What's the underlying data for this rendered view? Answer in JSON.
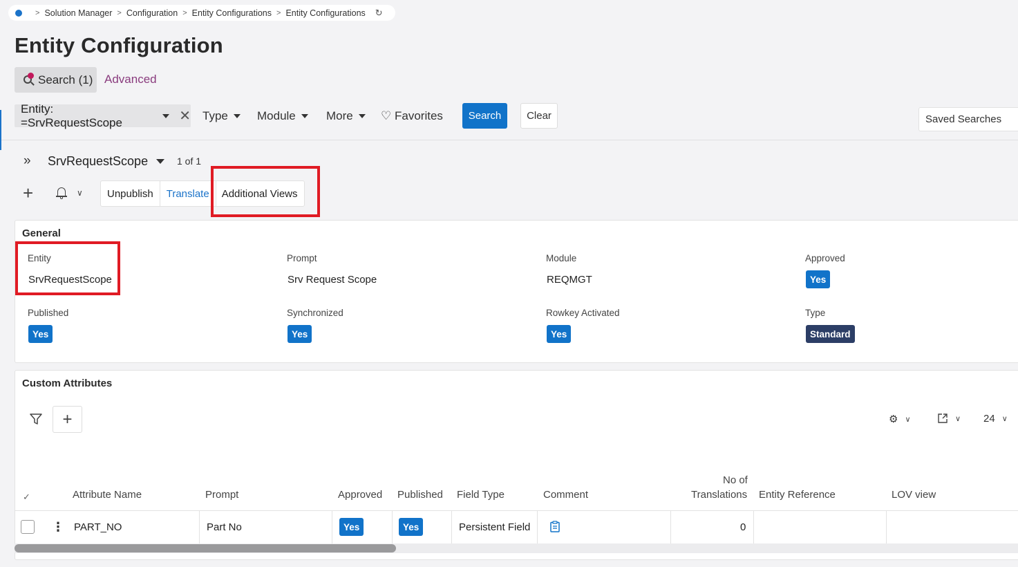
{
  "breadcrumb": {
    "items": [
      "Solution Manager",
      "Configuration",
      "Entity Configurations",
      "Entity Configurations"
    ],
    "separator": ">",
    "refresh_icon": "refresh-icon"
  },
  "page": {
    "title": "Entity Configuration"
  },
  "search_tabs": {
    "search_label": "Search (1)",
    "advanced_label": "Advanced"
  },
  "filter_bar": {
    "entity_filter": "Entity: =SrvRequestScope",
    "type_label": "Type",
    "module_label": "Module",
    "more_label": "More",
    "favorites_label": "Favorites",
    "search_button": "Search",
    "clear_button": "Clear",
    "saved_searches": "Saved Searches"
  },
  "record": {
    "name": "SrvRequestScope",
    "count": "1 of 1"
  },
  "toolbar": {
    "unpublish": "Unpublish",
    "translate": "Translate",
    "additional_views": "Additional Views"
  },
  "general": {
    "title": "General",
    "entity_label": "Entity",
    "entity_value": "SrvRequestScope",
    "prompt_label": "Prompt",
    "prompt_value": "Srv Request Scope",
    "module_label": "Module",
    "module_value": "REQMGT",
    "approved_label": "Approved",
    "approved_value": "Yes",
    "published_label": "Published",
    "published_value": "Yes",
    "synchronized_label": "Synchronized",
    "synchronized_value": "Yes",
    "rowkey_label": "Rowkey Activated",
    "rowkey_value": "Yes",
    "type_label": "Type",
    "type_value": "Standard"
  },
  "custom_attributes": {
    "title": "Custom Attributes",
    "page_size": "24",
    "columns": {
      "attribute_name": "Attribute Name",
      "prompt": "Prompt",
      "approved": "Approved",
      "published": "Published",
      "field_type": "Field Type",
      "comment": "Comment",
      "no_of_translations_1": "No of",
      "no_of_translations_2": "Translations",
      "entity_reference": "Entity Reference",
      "lov_view": "LOV view"
    },
    "rows": [
      {
        "attribute_name": "PART_NO",
        "prompt": "Part No",
        "approved": "Yes",
        "published": "Yes",
        "field_type": "Persistent Field",
        "comment_icon": "clipboard-icon",
        "no_of_translations": "0",
        "entity_reference": "",
        "lov_view": ""
      }
    ]
  },
  "colors": {
    "accent": "#1173c9",
    "badge_dark": "#2c3e66",
    "highlight": "#e01b24",
    "advanced": "#8a3c7e"
  }
}
